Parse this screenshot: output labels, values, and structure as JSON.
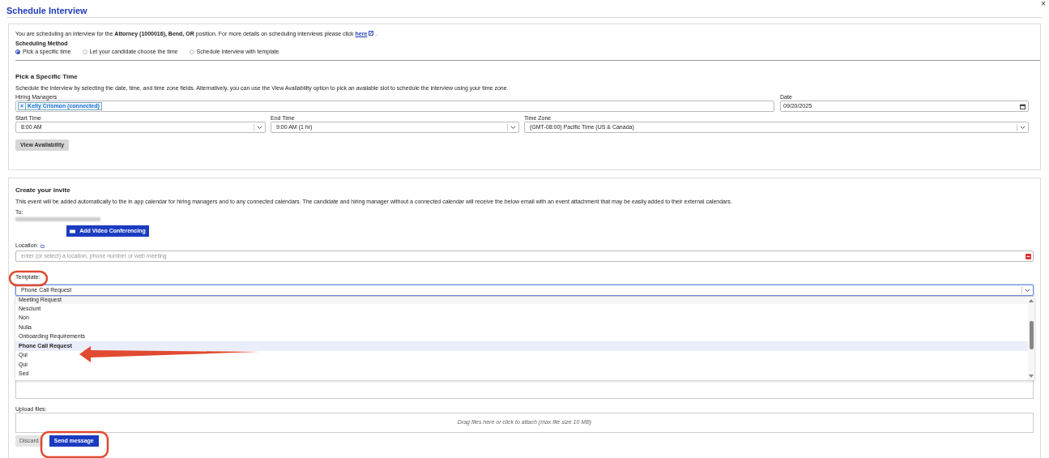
{
  "dialog": {
    "title": "Schedule Interview",
    "close": "×"
  },
  "scheduling": {
    "intro": "You are scheduling an interview for the **Attorney (1000016), Bend, OR** position. For more details on scheduling interviews please click",
    "intro_link": "here",
    "intro_end": ".",
    "method_label": "Scheduling Method",
    "methods": [
      {
        "label": "Pick a specific time",
        "selected": true
      },
      {
        "label": "Let your candidate choose the time",
        "selected": false
      },
      {
        "label": "Schedule interview with template",
        "selected": false
      }
    ]
  },
  "specific_time": {
    "heading": "Pick a Specific Time",
    "description": "Schedule the interview by selecting the date, time, and time zone fields. Alternatively, you can use the View Availability option to pick an available slot to schedule the interview using your time zone.",
    "hiring_managers": {
      "label": "Hiring Managers",
      "tokens": [
        {
          "label": "Kelly Crismon (connected)",
          "remove": "×"
        }
      ]
    },
    "date": {
      "label": "Date",
      "value": "09/20/2025"
    },
    "start_time": {
      "label": "Start Time",
      "value": "8:00 AM"
    },
    "end_time": {
      "label": "End Time",
      "value": "9:00 AM (1 hr)"
    },
    "time_zone": {
      "label": "Time Zone",
      "value": "(GMT-08:00) Pacific Time (US & Canada)"
    },
    "view_availability": "View Availability"
  },
  "invite": {
    "heading": "Create your invite",
    "description": "This event will be added automatically to the in app calendar for hiring managers and to any connected calendars. The candidate and hiring manager without a connected calendar will receive the below email with an event attachment that may be easily added to their external calendars.",
    "to_label": "To:",
    "add_video_button": "Add Video Conferencing",
    "location": {
      "label": "Location:",
      "placeholder": "enter (or select) a location, phone number or web meeting"
    },
    "template": {
      "label": "Template:",
      "value": "Phone Call Request",
      "expanded": true,
      "options": [
        {
          "label": "Meeting Request",
          "selected": false
        },
        {
          "label": "Nesciunt",
          "selected": false
        },
        {
          "label": "Non",
          "selected": false
        },
        {
          "label": "Nulla",
          "selected": false
        },
        {
          "label": "Onboarding Requirements",
          "selected": false
        },
        {
          "label": "Phone Call Request",
          "selected": true
        },
        {
          "label": "Qui",
          "selected": false
        },
        {
          "label": "Qui",
          "selected": false
        },
        {
          "label": "Sed",
          "selected": false
        }
      ]
    },
    "upload_label": "Upload files:",
    "upload_hint": "Drag files here or click to attach (max file size 10 MB)",
    "discard_button": "Discard",
    "send_button": "Send message"
  }
}
